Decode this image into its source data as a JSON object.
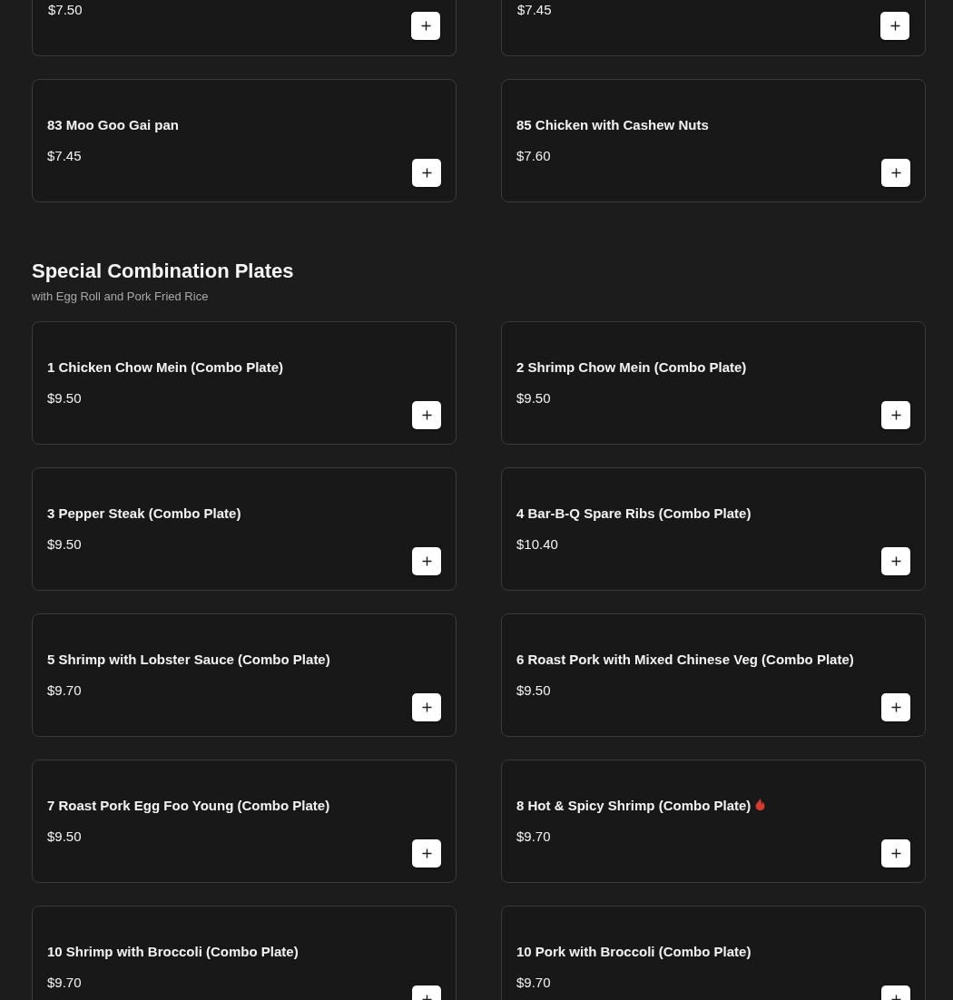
{
  "sections": [
    {
      "items": [
        {
          "kind": "cut",
          "price": "$7.50",
          "spicy": false
        },
        {
          "kind": "cut",
          "price": "$7.45",
          "spicy": false
        },
        {
          "kind": "full",
          "name": "83 Moo Goo Gai pan",
          "price": "$7.45",
          "spicy": false
        },
        {
          "kind": "full",
          "name": "85 Chicken with Cashew Nuts",
          "price": "$7.60",
          "spicy": false
        }
      ]
    },
    {
      "title": "Special Combination Plates",
      "subtitle": "with Egg Roll and Pork Fried Rice",
      "items": [
        {
          "kind": "full",
          "name": "1 Chicken Chow Mein (Combo Plate)",
          "price": "$9.50",
          "spicy": false
        },
        {
          "kind": "full",
          "name": "2 Shrimp Chow Mein (Combo Plate)",
          "price": "$9.50",
          "spicy": false
        },
        {
          "kind": "full",
          "name": "3 Pepper Steak (Combo Plate)",
          "price": "$9.50",
          "spicy": false
        },
        {
          "kind": "full",
          "name": "4 Bar-B-Q Spare Ribs (Combo Plate)",
          "price": "$10.40",
          "spicy": false
        },
        {
          "kind": "full",
          "name": "5 Shrimp with Lobster Sauce (Combo Plate)",
          "price": "$9.70",
          "spicy": false
        },
        {
          "kind": "full",
          "name": "6 Roast Pork with Mixed Chinese Veg (Combo Plate)",
          "price": "$9.50",
          "spicy": false
        },
        {
          "kind": "full",
          "name": "7 Roast Pork Egg Foo Young (Combo Plate)",
          "price": "$9.50",
          "spicy": false
        },
        {
          "kind": "full",
          "name": "8 Hot & Spicy Shrimp (Combo Plate)",
          "price": "$9.70",
          "spicy": true
        },
        {
          "kind": "full",
          "name": "10 Shrimp with Broccoli (Combo Plate)",
          "price": "$9.70",
          "spicy": false
        },
        {
          "kind": "full",
          "name": "10 Pork with Broccoli (Combo Plate)",
          "price": "$9.70",
          "spicy": false
        }
      ]
    }
  ]
}
